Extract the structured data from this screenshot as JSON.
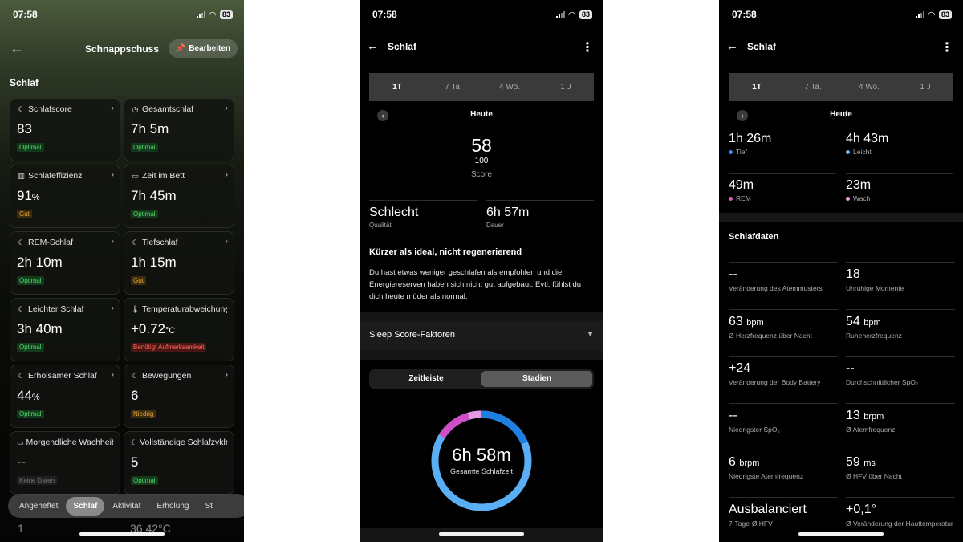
{
  "status": {
    "time": "07:58",
    "battery": "83"
  },
  "screen1": {
    "title": "Schnappschuss",
    "edit_label": "Bearbeiten",
    "section": "Schlaf",
    "cards": [
      {
        "label": "Schlafscore",
        "icon": "moon-icon",
        "glyph": "☾",
        "value": "83",
        "unit": "",
        "badge": "Optimal",
        "badge_type": "opt"
      },
      {
        "label": "Gesamtschlaf",
        "icon": "clock-icon",
        "glyph": "◷",
        "value": "7h 5m",
        "unit": "",
        "badge": "Optimal",
        "badge_type": "opt"
      },
      {
        "label": "Schlafeffizienz",
        "icon": "bar-chart-icon",
        "glyph": "▥",
        "value": "91",
        "unit": "%",
        "badge": "Gut",
        "badge_type": "gut"
      },
      {
        "label": "Zeit im Bett",
        "icon": "bed-icon",
        "glyph": "▭",
        "value": "7h 45m",
        "unit": "",
        "badge": "Optimal",
        "badge_type": "opt"
      },
      {
        "label": "REM-Schlaf",
        "icon": "moon-icon",
        "glyph": "☾",
        "value": "2h 10m",
        "unit": "",
        "badge": "Optimal",
        "badge_type": "opt"
      },
      {
        "label": "Tiefschlaf",
        "icon": "moon-icon",
        "glyph": "☾",
        "value": "1h 15m",
        "unit": "",
        "badge": "Gut",
        "badge_type": "gut"
      },
      {
        "label": "Leichter Schlaf",
        "icon": "moon-icon",
        "glyph": "☾",
        "value": "3h 40m",
        "unit": "",
        "badge": "Optimal",
        "badge_type": "opt"
      },
      {
        "label": "Temperaturabweichung",
        "icon": "thermometer-icon",
        "glyph": "🌡",
        "value": "+0.72",
        "unit": "°C",
        "badge": "Benötigt Aufmerksamkeit",
        "badge_type": "warn"
      },
      {
        "label": "Erholsamer Schlaf",
        "icon": "moon-icon",
        "glyph": "☾",
        "value": "44",
        "unit": "%",
        "badge": "Optimal",
        "badge_type": "opt"
      },
      {
        "label": "Bewegungen",
        "icon": "moon-icon",
        "glyph": "☾",
        "value": "6",
        "unit": "",
        "badge": "Niedrig",
        "badge_type": "gut"
      },
      {
        "label": "Morgendliche Wachheit",
        "icon": "bed-icon",
        "glyph": "▭",
        "value": "--",
        "unit": "",
        "badge": "Keine Daten",
        "badge_type": "none"
      },
      {
        "label": "Vollständige Schlafzyklen",
        "icon": "moon-icon",
        "glyph": "☾",
        "value": "5",
        "unit": "",
        "badge": "Optimal",
        "badge_type": "opt"
      }
    ],
    "tabs": [
      "Angeheftet",
      "Schlaf",
      "Aktivität",
      "Erholung",
      "St"
    ],
    "active_tab": "Schlaf",
    "peek_left": "1",
    "peek_right": "36,42°C"
  },
  "screen2": {
    "title": "Schlaf",
    "periods": [
      "1T",
      "7 Ta.",
      "4 Wo.",
      "1 J"
    ],
    "active_period": "1T",
    "day": "Heute",
    "score": "58",
    "score_max": "100",
    "score_label": "Score",
    "quality_value": "Schlecht",
    "quality_label": "Qualität",
    "duration_value": "6h 57m",
    "duration_label": "Dauer",
    "headline": "Kürzer als ideal, nicht regenerierend",
    "paragraph": "Du hast etwas weniger geschlafen als empfohlen und die Energiereserven haben sich nicht gut aufgebaut. Evtl. fühlst du dich heute müder als normal.",
    "factors_label": "Sleep Score-Faktoren",
    "toggle": [
      "Zeitleiste",
      "Stadien"
    ],
    "active_toggle": "Stadien",
    "donut_value": "6h 58m",
    "donut_label": "Gesamte Schlafzeit",
    "colors": {
      "deep": "#1f7fe0",
      "light": "#5aaef5",
      "rem": "#cf4fc7",
      "awake": "#e79be3"
    }
  },
  "screen3": {
    "title": "Schlaf",
    "periods": [
      "1T",
      "7 Ta.",
      "4 Wo.",
      "1 J"
    ],
    "active_period": "1T",
    "day": "Heute",
    "stages": [
      {
        "value": "1h 26m",
        "label": "Tief",
        "color": "#2f8ef0"
      },
      {
        "value": "4h 43m",
        "label": "Leicht",
        "color": "#6bb8f7"
      },
      {
        "value": "49m",
        "label": "REM",
        "color": "#d35bcc"
      },
      {
        "value": "23m",
        "label": "Wach",
        "color": "#ee9fe6"
      }
    ],
    "section_title": "Schlafdaten",
    "data": [
      {
        "value": "--",
        "unit": "",
        "label": "Veränderung des Atemmusters"
      },
      {
        "value": "18",
        "unit": "",
        "label": "Unruhige Momente"
      },
      {
        "value": "63",
        "unit": "bpm",
        "label": "Ø Herzfrequenz über Nacht"
      },
      {
        "value": "54",
        "unit": "bpm",
        "label": "Ruheherzfrequenz"
      },
      {
        "value": "+24",
        "unit": "",
        "label": "Veränderung der Body Battery"
      },
      {
        "value": "--",
        "unit": "",
        "label": "Durchschnittlicher SpO₂"
      },
      {
        "value": "--",
        "unit": "",
        "label": "Niedrigster SpO₂"
      },
      {
        "value": "13",
        "unit": "brpm",
        "label": "Ø Atemfrequenz"
      },
      {
        "value": "6",
        "unit": "brpm",
        "label": "Niedrigste Atemfrequenz"
      },
      {
        "value": "59",
        "unit": "ms",
        "label": "Ø HFV über Nacht"
      },
      {
        "value": "Ausbalanciert",
        "unit": "",
        "label": "7-Tage-Ø HFV"
      },
      {
        "value": "+0,1°",
        "unit": "",
        "label": "Ø Veränderung der Hauttemperatur"
      }
    ]
  }
}
